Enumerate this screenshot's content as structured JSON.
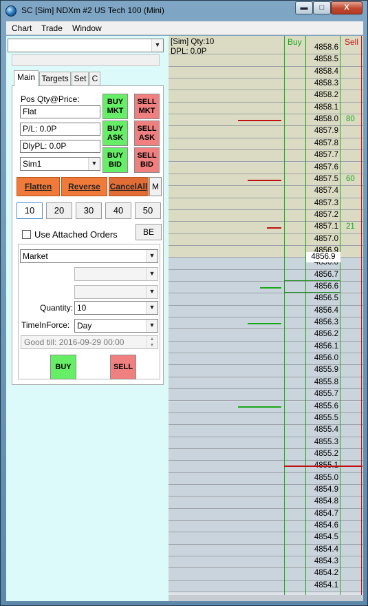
{
  "window": {
    "title": "SC [Sim] NDXm  #2  US Tech 100 (Mini)",
    "close_label": "X"
  },
  "menu": [
    "Chart",
    "Trade",
    "Window"
  ],
  "account_select": {
    "value": ""
  },
  "tabs": [
    "Main",
    "Targets",
    "Set",
    "C"
  ],
  "main": {
    "pos_label": "Pos Qty@Price:",
    "pos_value": "Flat",
    "pl_value": "P/L: 0.0P",
    "dlypl_value": "DlyPL: 0.0P",
    "account": "Sim1",
    "buy_mkt": "BUY MKT",
    "sell_mkt": "SELL MKT",
    "buy_ask": "BUY ASK",
    "sell_ask": "SELL ASK",
    "buy_bid": "BUY BID",
    "sell_bid": "SELL BID",
    "flatten": "Flatten",
    "reverse": "Reverse",
    "cancel_all": "CancelAll",
    "m": "M",
    "quantities": [
      "10",
      "20",
      "30",
      "40",
      "50"
    ],
    "attached_label": "Use Attached Orders",
    "be": "BE",
    "order_type": "Market",
    "quantity_label": "Quantity:",
    "quantity_value": "10",
    "tif_label": "TimeInForce:",
    "tif_value": "Day",
    "good_till": "Good till: 2016-09-29 00:00",
    "buy": "BUY",
    "sell": "SELL"
  },
  "ladder": {
    "info_line1": "[Sim]  Qty:10",
    "info_line2": "DPL: 0.0P",
    "buy_header": "Buy",
    "sell_header": "Sell",
    "last_price": "4856.9",
    "current_price": "4856.6",
    "prices": [
      "4858.6",
      "4858.5",
      "4858.4",
      "4858.3",
      "4858.2",
      "4858.1",
      "4858.0",
      "4857.9",
      "4857.8",
      "4857.7",
      "4857.6",
      "4857.5",
      "4857.4",
      "4857.3",
      "4857.2",
      "4857.1",
      "4857.0",
      "4856.9",
      "4856.8",
      "4856.7",
      "4856.6",
      "4856.5",
      "4856.4",
      "4856.3",
      "4856.2",
      "4856.1",
      "4856.0",
      "4855.9",
      "4855.8",
      "4855.7",
      "4855.6",
      "4855.5",
      "4855.4",
      "4855.3",
      "4855.2",
      "4855.1",
      "4855.0",
      "4854.9",
      "4854.8",
      "4854.7",
      "4854.6",
      "4854.5",
      "4854.4",
      "4854.3",
      "4854.2",
      "4854.1"
    ],
    "ask_levels": 18,
    "sell_sizes": {
      "4858.0": "80",
      "4857.5": "60",
      "4857.1": "21"
    },
    "sell_volume_bars": {
      "4858.0": 0.9,
      "4857.5": 0.7,
      "4857.1": 0.3
    },
    "buy_volume_bars": {
      "4856.6": 0.45,
      "4856.3": 0.7,
      "4855.6": 0.9
    },
    "colors": {
      "ask_row": "#dbdbc3",
      "bid_row": "#cad4dc",
      "buy": "#1aa81a",
      "sell": "#c01010"
    }
  }
}
